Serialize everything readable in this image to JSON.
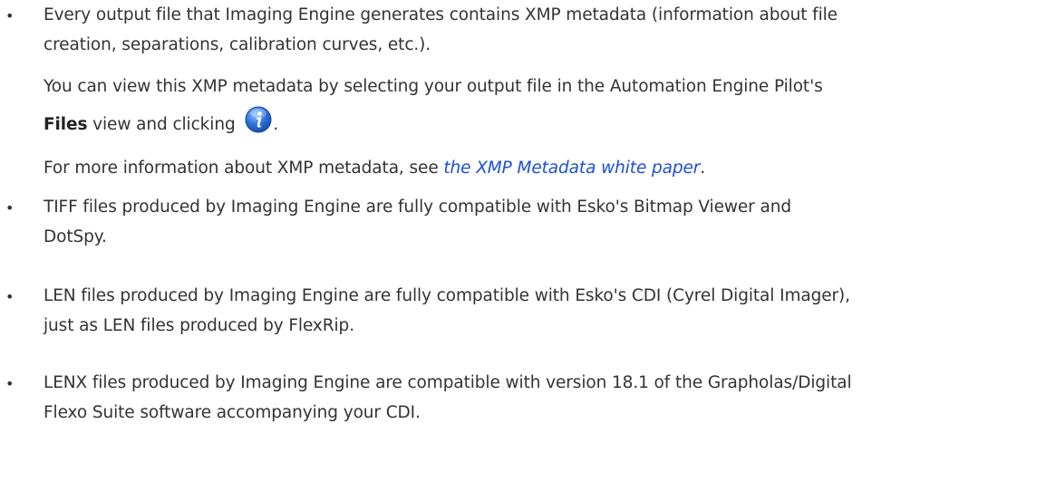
{
  "bullets": [
    {
      "line1": "Every output file that Imaging Engine generates contains XMP metadata (information about file",
      "line2": "creation, separations, calibration curves, etc.).",
      "para2": "You can view this XMP metadata by selecting your output file in the Automation Engine Pilot's",
      "files_bold": "Files",
      "files_rest": " view and clicking ",
      "after_icon": ".",
      "icon": "info-icon",
      "para3_before": "For more information about XMP metadata, see ",
      "para3_link": "the XMP Metadata white paper",
      "para3_after": "."
    },
    {
      "line1": "TIFF files produced by Imaging Engine are fully compatible with Esko's Bitmap Viewer and",
      "line2": "DotSpy."
    },
    {
      "line1": "LEN files produced by Imaging Engine are fully compatible with Esko's CDI (Cyrel Digital Imager),",
      "line2": "just as LEN files produced by FlexRip."
    },
    {
      "line1": "LENX files produced by Imaging Engine are compatible with version 18.1 of the Grapholas/Digital",
      "line2": "Flexo Suite software accompanying your CDI."
    }
  ],
  "bullet_char": "•",
  "colors": {
    "text": "#333333",
    "link": "#1a4fd6",
    "icon": "#2b6fd6"
  }
}
